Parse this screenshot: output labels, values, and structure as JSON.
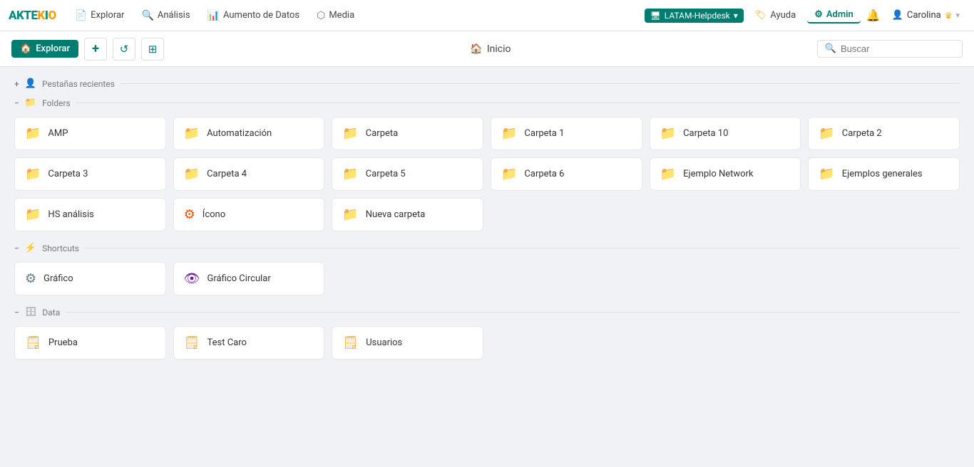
{
  "app": {
    "logo": "AKTEKIO",
    "logo_parts": [
      "AK",
      "TE",
      "KI",
      "O"
    ]
  },
  "topnav": {
    "items": [
      {
        "id": "explorar",
        "label": "Explorar",
        "icon": "📄"
      },
      {
        "id": "analisis",
        "label": "Análisis",
        "icon": "🔍"
      },
      {
        "id": "aumento",
        "label": "Aumento de Datos",
        "icon": "📊"
      },
      {
        "id": "media",
        "label": "Media",
        "icon": "⬡"
      }
    ],
    "workspace": "LATAM-Helpdesk",
    "help_label": "Ayuda",
    "admin_label": "Admin",
    "user_label": "Carolina"
  },
  "explorer": {
    "label": "Explorar",
    "home_label": "Inicio",
    "search_placeholder": "Buscar",
    "add_tooltip": "+",
    "refresh_tooltip": "↺",
    "layout_tooltip": "⊞"
  },
  "sections": {
    "recent": {
      "label": "Pestañas recientes",
      "collapsed": false
    },
    "folders": {
      "label": "Folders",
      "collapsed": false,
      "items": [
        {
          "id": "amp",
          "name": "AMP",
          "icon_color": "fi-teal",
          "icon": "📁"
        },
        {
          "id": "automatizacion",
          "name": "Automatización",
          "icon_color": "fi-dark-teal",
          "icon": "📁"
        },
        {
          "id": "carpeta",
          "name": "Carpeta",
          "icon_color": "fi-light-teal",
          "icon": "📁"
        },
        {
          "id": "carpeta1",
          "name": "Carpeta 1",
          "icon_color": "fi-blue",
          "icon": "📁"
        },
        {
          "id": "carpeta10",
          "name": "Carpeta 10",
          "icon_color": "fi-green",
          "icon": "📁"
        },
        {
          "id": "carpeta2",
          "name": "Carpeta 2",
          "icon_color": "fi-dark-teal",
          "icon": "📁"
        },
        {
          "id": "carpeta3",
          "name": "Carpeta 3",
          "icon_color": "fi-teal",
          "icon": "📁"
        },
        {
          "id": "carpeta4",
          "name": "Carpeta 4",
          "icon_color": "fi-dark-teal",
          "icon": "📁"
        },
        {
          "id": "carpeta5",
          "name": "Carpeta 5",
          "icon_color": "fi-light-teal",
          "icon": "📁"
        },
        {
          "id": "carpeta6",
          "name": "Carpeta 6",
          "icon_color": "fi-blue",
          "icon": "📁"
        },
        {
          "id": "ejemplo-network",
          "name": "Ejemplo Network",
          "icon_color": "fi-green",
          "icon": "📁"
        },
        {
          "id": "ejemplos-generales",
          "name": "Ejemplos generales",
          "icon_color": "fi-dark-teal",
          "icon": "📁"
        },
        {
          "id": "hs-analisis",
          "name": "HS análisis",
          "icon_color": "fi-teal",
          "icon": "📁"
        },
        {
          "id": "icono",
          "name": "Ícono",
          "icon_color": "fi-orange",
          "icon": "⚙"
        },
        {
          "id": "nueva-carpeta",
          "name": "Nueva carpeta",
          "icon_color": "fi-red",
          "icon": "📁"
        }
      ]
    },
    "shortcuts": {
      "label": "Shortcuts",
      "collapsed": false,
      "items": [
        {
          "id": "grafico",
          "name": "Gráfico",
          "icon_color": "fi-gray",
          "icon": "⚙"
        },
        {
          "id": "grafico-circular",
          "name": "Gráfico Circular",
          "icon_color": "fi-purple",
          "icon": "👁"
        }
      ]
    },
    "data": {
      "label": "Data",
      "collapsed": false,
      "items": [
        {
          "id": "prueba",
          "name": "Prueba",
          "icon_color": "fi-yellow",
          "icon": "🗒"
        },
        {
          "id": "test-caro",
          "name": "Test Caro",
          "icon_color": "fi-yellow",
          "icon": "🗒"
        },
        {
          "id": "usuarios",
          "name": "Usuarios",
          "icon_color": "fi-yellow",
          "icon": "🗒"
        }
      ]
    }
  }
}
